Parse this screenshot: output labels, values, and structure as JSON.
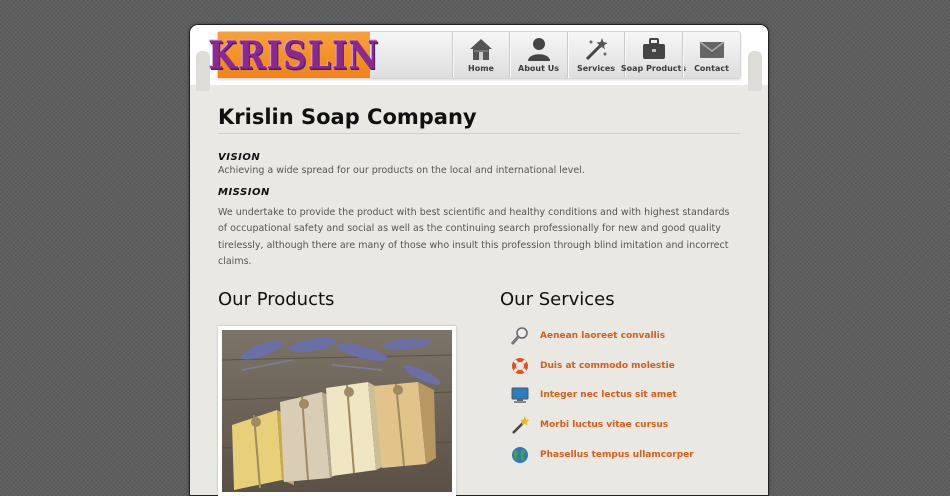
{
  "logo": {
    "text": "KRISLIN"
  },
  "nav": {
    "items": [
      {
        "label": "Home",
        "icon": "home-icon"
      },
      {
        "label": "About Us",
        "icon": "user-icon"
      },
      {
        "label": "Services",
        "icon": "magic-wand-icon"
      },
      {
        "label": "Soap Products",
        "icon": "briefcase-icon"
      },
      {
        "label": "Contact",
        "icon": "envelope-icon"
      }
    ]
  },
  "main": {
    "title": "Krislin Soap Company",
    "vision_heading": "VISION",
    "vision_text": "Achieving a wide spread for our products on the local and international level.",
    "mission_heading": "MISSION",
    "mission_text": "We undertake to provide the product with best scientific and healthy conditions and with highest standards of occupational safety and social as well as the continuing search professionally for new and good quality tirelessly, although there are many of those who insult this profession through blind imitation and incorrect claims."
  },
  "products": {
    "heading": "Our Products"
  },
  "services": {
    "heading": "Our Services",
    "items": [
      {
        "label": "Aenean laoreet convallis",
        "icon": "magnifier-icon"
      },
      {
        "label": "Duis at commodo molestie",
        "icon": "lifebuoy-icon"
      },
      {
        "label": "Integer nec lectus sit amet",
        "icon": "monitor-icon"
      },
      {
        "label": "Morbi luctus vitae cursus",
        "icon": "magic-wand-icon"
      },
      {
        "label": "Phasellus tempus ullamcorper",
        "icon": "globe-icon"
      }
    ]
  },
  "colors": {
    "accent": "#d45e1a",
    "logo_bg": "#f28c1e",
    "logo_text": "#8b2a8e",
    "page_bg": "#5e5e5e"
  }
}
